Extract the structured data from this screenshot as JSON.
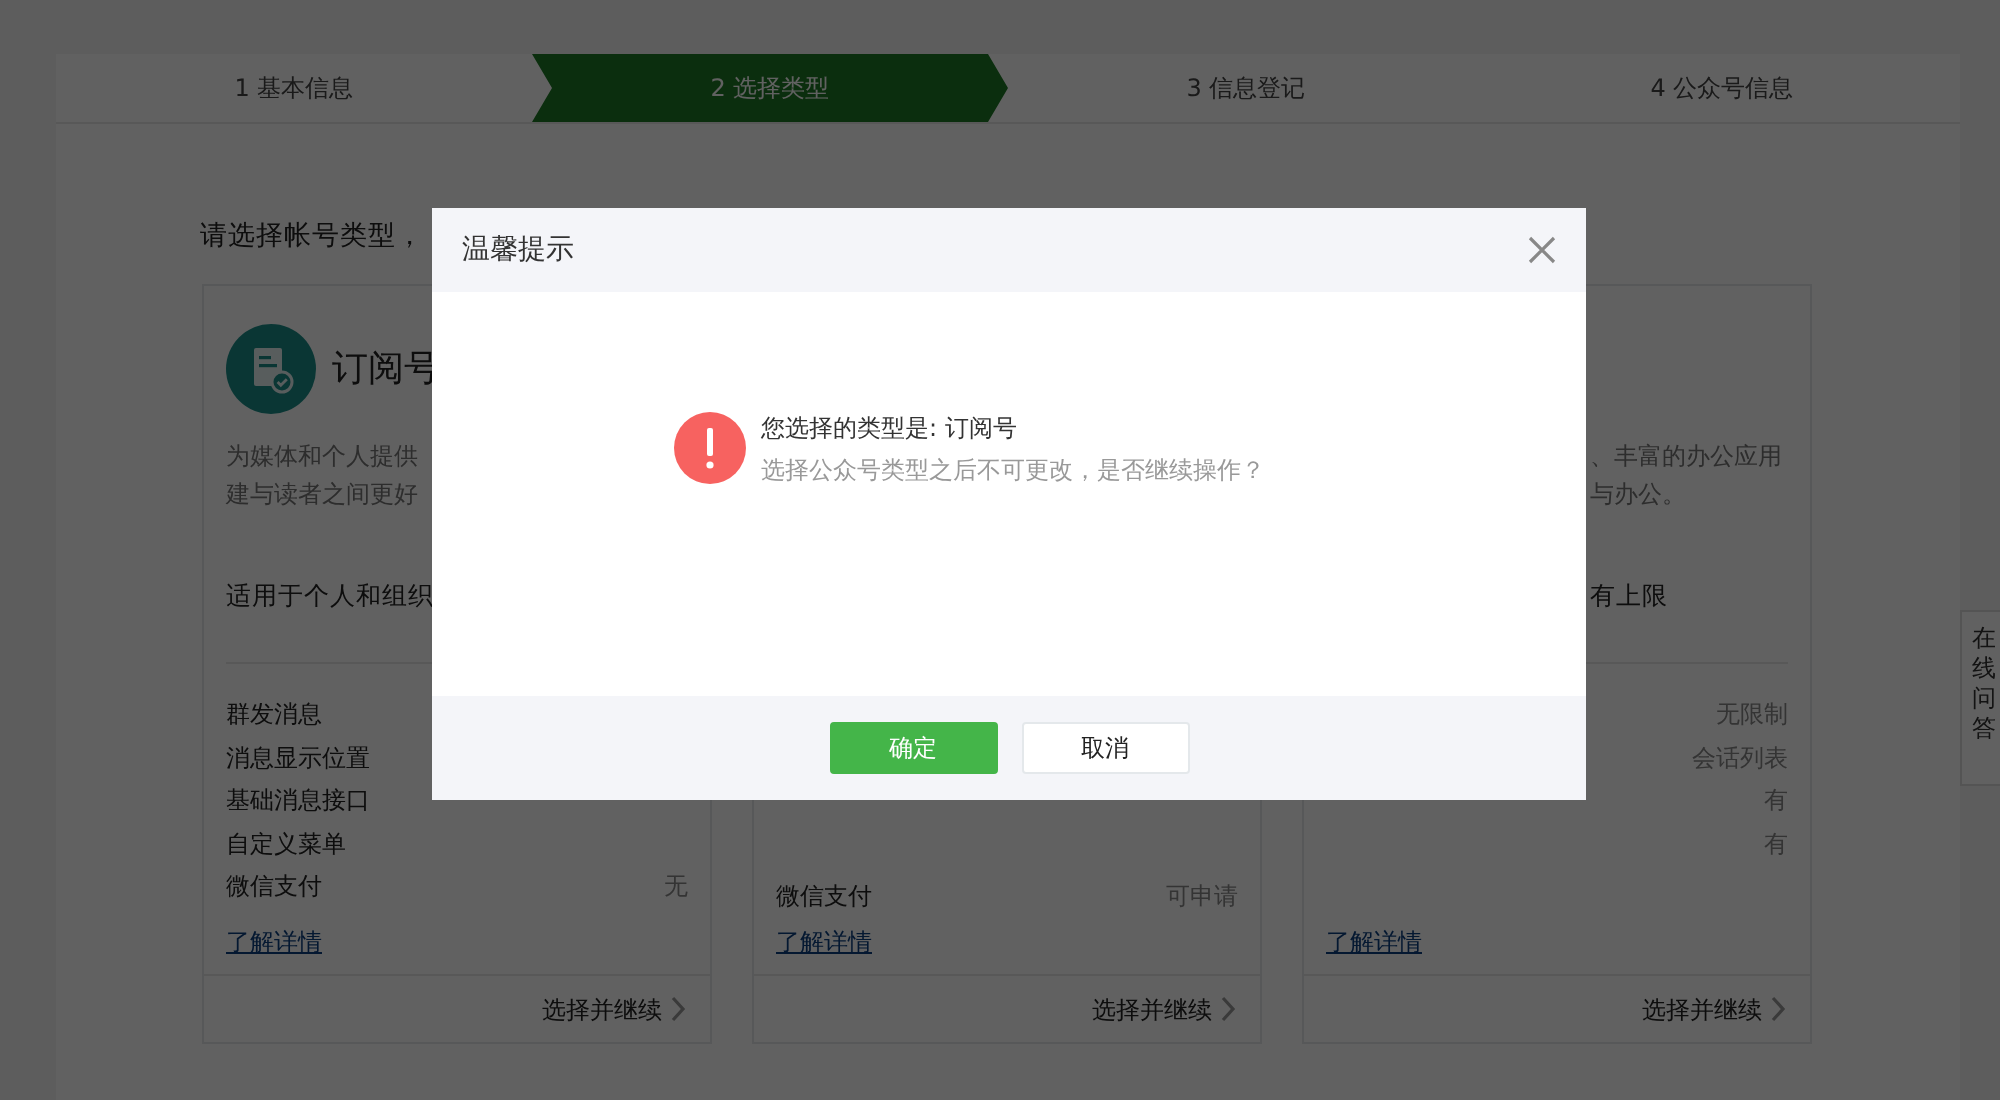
{
  "steps": [
    {
      "label": "1 基本信息",
      "selected": false
    },
    {
      "label": "2 选择类型",
      "selected": true
    },
    {
      "label": "3 信息登记",
      "selected": false
    },
    {
      "label": "4 公众号信息",
      "selected": false
    }
  ],
  "intro": "请选择帐号类型，",
  "cards": [
    {
      "title": "订阅号",
      "description": [
        "为媒体和个人提供",
        "建与读者之间更好"
      ],
      "audience": "适用于个人和组织",
      "features": [
        {
          "label": "群发消息"
        },
        {
          "label": "消息显示位置"
        },
        {
          "label": "基础消息接口"
        },
        {
          "label": "自定义菜单"
        },
        {
          "label": "微信支付",
          "value": "无"
        }
      ],
      "link": "了解详情",
      "action": "选择并继续"
    },
    {
      "features": [
        {
          "label": "微信支付",
          "value": "可申请"
        }
      ],
      "link": "了解详情",
      "action": "选择并继续"
    },
    {
      "description": [
        "、丰富的办公应用",
        "与办公。"
      ],
      "audience": "有上限",
      "features": [
        {
          "value": "无限制"
        },
        {
          "value": "会话列表"
        },
        {
          "value": "有"
        },
        {
          "value": "有"
        }
      ],
      "link": "了解详情",
      "action": "选择并继续"
    }
  ],
  "side_tab": "在线问答",
  "dialog": {
    "title": "温馨提示",
    "message": "您选择的类型是: 订阅号",
    "note": "选择公众号类型之后不可更改，是否继续操作？",
    "buttons": [
      {
        "label": "确定",
        "kind": "primary"
      },
      {
        "label": "取消",
        "kind": "default"
      }
    ]
  }
}
